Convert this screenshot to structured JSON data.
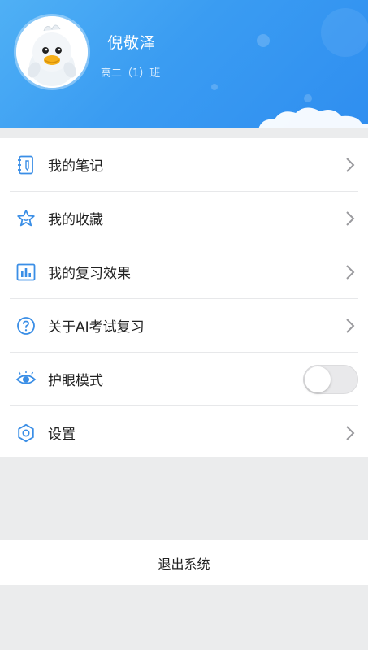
{
  "profile": {
    "name": "倪敬泽",
    "class_name": "高二（1）班",
    "avatar_icon": "duck-avatar-icon"
  },
  "menu": {
    "items": [
      {
        "label": "我的笔记",
        "icon": "notebook-icon"
      },
      {
        "label": "我的收藏",
        "icon": "star-icon"
      },
      {
        "label": "我的复习效果",
        "icon": "bar-chart-icon"
      },
      {
        "label": "关于AI考试复习",
        "icon": "question-circle-icon"
      },
      {
        "label": "护眼模式",
        "icon": "eye-icon",
        "toggle_on": false
      },
      {
        "label": "设置",
        "icon": "gear-icon"
      }
    ]
  },
  "logout_label": "退出系统",
  "colors": {
    "header_start": "#4fb0f5",
    "header_end": "#2f8ef0",
    "icon_blue": "#3a8ee6",
    "page_bg": "#ebeced"
  }
}
